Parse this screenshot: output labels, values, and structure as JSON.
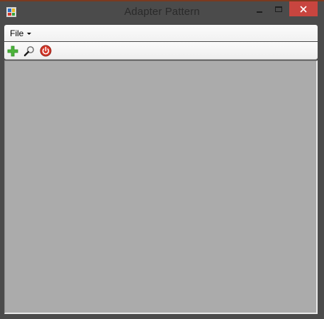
{
  "window": {
    "title": "Adapter Pattern",
    "app_icon": "windows-form-icon",
    "controls": {
      "minimize_icon": "minimize-icon",
      "maximize_icon": "maximize-icon",
      "close_icon": "close-icon",
      "close_color": "#c8453f"
    }
  },
  "menubar": {
    "items": [
      {
        "label": "File",
        "icon": "chevron-down-icon"
      }
    ]
  },
  "toolbar": {
    "buttons": [
      {
        "icon": "add-icon",
        "color": "#3aa13a"
      },
      {
        "icon": "search-icon",
        "color": "#555555"
      },
      {
        "icon": "power-icon",
        "color": "#d23a2a"
      }
    ]
  },
  "client_area": {
    "background": "#ababab"
  }
}
